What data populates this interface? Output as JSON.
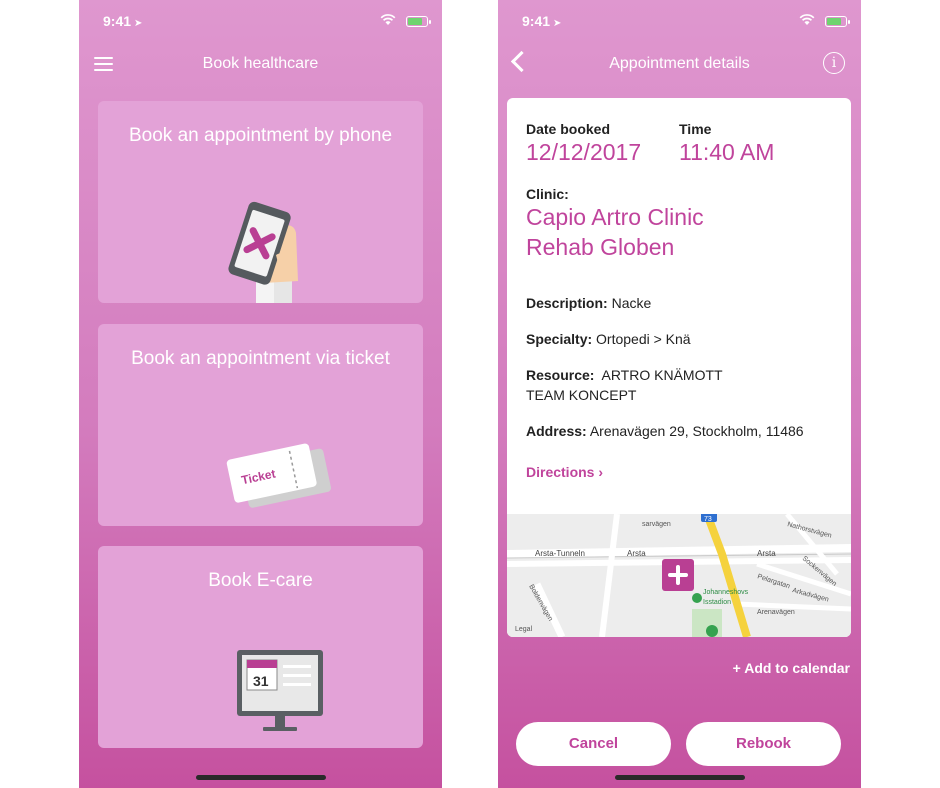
{
  "status": {
    "time": "9:41"
  },
  "left": {
    "nav_title": "Book healthcare",
    "cards": [
      {
        "title": "Book an appointment by phone"
      },
      {
        "title": "Book an appointment via ticket",
        "ticket_text": "Ticket"
      },
      {
        "title": "Book E-care",
        "calendar_day": "31"
      }
    ]
  },
  "right": {
    "nav_title": "Appointment details",
    "date_label": "Date booked",
    "date_value": "12/12/2017",
    "time_label": "Time",
    "time_value": "11:40 AM",
    "clinic_label": "Clinic:",
    "clinic_line1": "Capio Artro Clinic",
    "clinic_line2": "Rehab Globen",
    "description_label": "Description:",
    "description_value": "Nacke",
    "specialty_label": "Specialty:",
    "specialty_value": "Ortopedi > Knä",
    "resource_label": "Resource:",
    "resource_line1": "ARTRO KNÄMOTT",
    "resource_line2": "TEAM KONCEPT",
    "address_label": "Address:",
    "address_value": "Arenavägen 29, Stockholm, 11486",
    "directions": "Directions ›",
    "map_labels": {
      "arsta_tunneln": "Arsta-Tunneln",
      "arsta1": "Arsta",
      "arsta2": "Arsta",
      "sarvagen": "sarvägen",
      "boldenvagen": "Boldenvägen",
      "johanneshovs1": "Johanneshovs",
      "johanneshovs2": "Isstadion",
      "nathorst": "Nathorstvägen",
      "sockenvagen": "Sockenvägen",
      "pelargatan": "Pelargatan",
      "arkadvagen": "Arkadvägen",
      "arenavagen": "Arenavägen",
      "legal": "Legal",
      "route": "73"
    },
    "add_to_calendar": "+ Add to calendar",
    "cancel": "Cancel",
    "rebook": "Rebook"
  },
  "colors": {
    "accent": "#c0449c",
    "background_top": "#df97cf",
    "background_bottom": "#c5519f",
    "card": "#e3a2d7"
  }
}
